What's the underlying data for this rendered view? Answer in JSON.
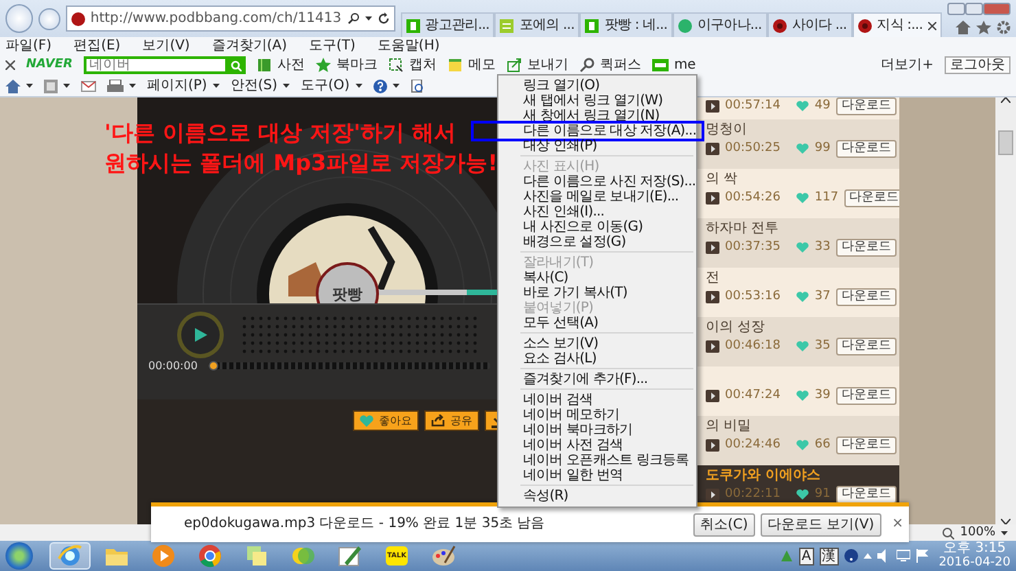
{
  "browser": {
    "url": "http://www.podbbang.com/ch/11413"
  },
  "tabs": [
    {
      "label": "광고관리...",
      "kind": "naver",
      "selected": false
    },
    {
      "label": "포에의 ...",
      "kind": "news",
      "selected": false
    },
    {
      "label": "팟빵 : 네...",
      "kind": "naver",
      "selected": false
    },
    {
      "label": "이구아나...",
      "kind": "circle",
      "selected": false
    },
    {
      "label": "사이다 ...",
      "kind": "podbbang",
      "selected": false
    },
    {
      "label": "지식 :...",
      "kind": "podbbang",
      "selected": true
    }
  ],
  "menu_bar": [
    "파일(F)",
    "편집(E)",
    "보기(V)",
    "즐겨찾기(A)",
    "도구(T)",
    "도움말(H)"
  ],
  "naver_toolbar": {
    "logo": "NAVER",
    "search_placeholder": "네이버",
    "items": [
      {
        "label": "사전",
        "kind": "book"
      },
      {
        "label": "북마크",
        "kind": "star"
      },
      {
        "label": "캡처",
        "kind": "capture"
      },
      {
        "label": "메모",
        "kind": "memo"
      },
      {
        "label": "보내기",
        "kind": "send"
      },
      {
        "label": "퀵퍼스",
        "kind": "search"
      },
      {
        "label": "me",
        "kind": "me"
      }
    ],
    "more": "더보기+",
    "logout": "로그아웃"
  },
  "command_bar": {
    "items": [
      "페이지(P)",
      "안전(S)",
      "도구(O)"
    ]
  },
  "annotation": [
    "'다른 이름으로 대상 저장'하기 해서",
    "원하시는 폴더에 Mp3파일로 저장가능!"
  ],
  "player": {
    "logo": "팟빵",
    "time": "00:00:00",
    "level": 0,
    "buttons": [
      {
        "label": "좋아요",
        "kind": "like"
      },
      {
        "label": "공유",
        "kind": "share"
      },
      {
        "kind": "download"
      }
    ]
  },
  "episodes": [
    {
      "time": "00:57:14",
      "likes": "49",
      "button": "다운로드",
      "selected": false
    },
    {
      "title": "멍청이",
      "time": "00:50:25",
      "likes": "99",
      "button": "다운로드",
      "selected": false
    },
    {
      "title": "의 싹",
      "time": "00:54:26",
      "likes": "117",
      "button": "다운로드",
      "selected": false
    },
    {
      "title": "하자마 전투",
      "time": "00:37:35",
      "likes": "33",
      "button": "다운로드",
      "selected": false
    },
    {
      "title": "전",
      "time": "00:53:16",
      "likes": "37",
      "button": "다운로드",
      "selected": false
    },
    {
      "title": "이의 성장",
      "time": "00:46:18",
      "likes": "35",
      "button": "다운로드",
      "selected": false
    },
    {
      "time": "00:47:24",
      "likes": "39",
      "button": "다운로드",
      "selected": false
    },
    {
      "title": "의 비밀",
      "time": "00:24:46",
      "likes": "66",
      "button": "다운로드",
      "selected": false
    },
    {
      "title": "도쿠가와 이에야스",
      "time": "00:22:11",
      "likes": "91",
      "button": "다운로드",
      "selected": true
    }
  ],
  "context_menu": [
    [
      {
        "label": "링크 열기(O)",
        "disabled": false,
        "framed": false
      },
      {
        "label": "새 탭에서 링크 열기(W)",
        "disabled": false,
        "framed": false
      },
      {
        "label": "새 창에서 링크 열기(N)",
        "disabled": false,
        "framed": false
      },
      {
        "label": "다른 이름으로 대상 저장(A)...",
        "disabled": false,
        "framed": true
      },
      {
        "label": "대상 인쇄(P)",
        "disabled": false,
        "framed": false
      }
    ],
    [
      {
        "label": "사진 표시(H)",
        "disabled": true,
        "framed": false
      },
      {
        "label": "다른 이름으로 사진 저장(S)...",
        "disabled": false,
        "framed": false
      },
      {
        "label": "사진을 메일로 보내기(E)...",
        "disabled": false,
        "framed": false
      },
      {
        "label": "사진 인쇄(I)...",
        "disabled": false,
        "framed": false
      },
      {
        "label": "내 사진으로 이동(G)",
        "disabled": false,
        "framed": false
      },
      {
        "label": "배경으로 설정(G)",
        "disabled": false,
        "framed": false
      }
    ],
    [
      {
        "label": "잘라내기(T)",
        "disabled": true,
        "framed": false
      },
      {
        "label": "복사(C)",
        "disabled": false,
        "framed": false
      },
      {
        "label": "바로 가기 복사(T)",
        "disabled": false,
        "framed": false
      },
      {
        "label": "붙여넣기(P)",
        "disabled": true,
        "framed": false
      },
      {
        "label": "모두 선택(A)",
        "disabled": false,
        "framed": false
      }
    ],
    [
      {
        "label": "소스 보기(V)",
        "disabled": false,
        "framed": false
      },
      {
        "label": "요소 검사(L)",
        "disabled": false,
        "framed": false
      }
    ],
    [
      {
        "label": "즐겨찾기에 추가(F)...",
        "disabled": false,
        "framed": false
      }
    ],
    [
      {
        "label": "네이버 검색",
        "disabled": false,
        "framed": false
      },
      {
        "label": "네이버 메모하기",
        "disabled": false,
        "framed": false
      },
      {
        "label": "네이버 북마크하기",
        "disabled": false,
        "framed": false
      },
      {
        "label": "네이버 사전 검색",
        "disabled": false,
        "framed": false
      },
      {
        "label": "네이버 오픈캐스트 링크등록",
        "disabled": false,
        "framed": false
      },
      {
        "label": "네이버 일한 번역",
        "disabled": false,
        "framed": false
      }
    ],
    [
      {
        "label": "속성(R)",
        "disabled": false,
        "framed": false
      }
    ]
  ],
  "download_bar": {
    "message": "ep0dokugawa.mp3 다운로드 - 19% 완료 1분 35초 남음",
    "buttons": [
      "취소(C)",
      "다운로드 보기(V)"
    ],
    "close": "×"
  },
  "status_bar": {
    "zoom": "100%"
  },
  "taskbar": {
    "pinned": [
      {
        "kind": "ie",
        "selected": true
      },
      {
        "kind": "folder",
        "selected": false
      },
      {
        "kind": "media",
        "selected": false
      },
      {
        "kind": "chrome",
        "selected": false
      },
      {
        "kind": "notes",
        "selected": false
      },
      {
        "kind": "circles",
        "selected": false
      },
      {
        "kind": "pen",
        "selected": false
      },
      {
        "kind": "talk",
        "label": "TALK",
        "selected": false
      },
      {
        "kind": "palette",
        "selected": false
      }
    ],
    "ime": [
      "A",
      "漢"
    ],
    "time": "오후 3:15",
    "date": "2016-04-20"
  }
}
